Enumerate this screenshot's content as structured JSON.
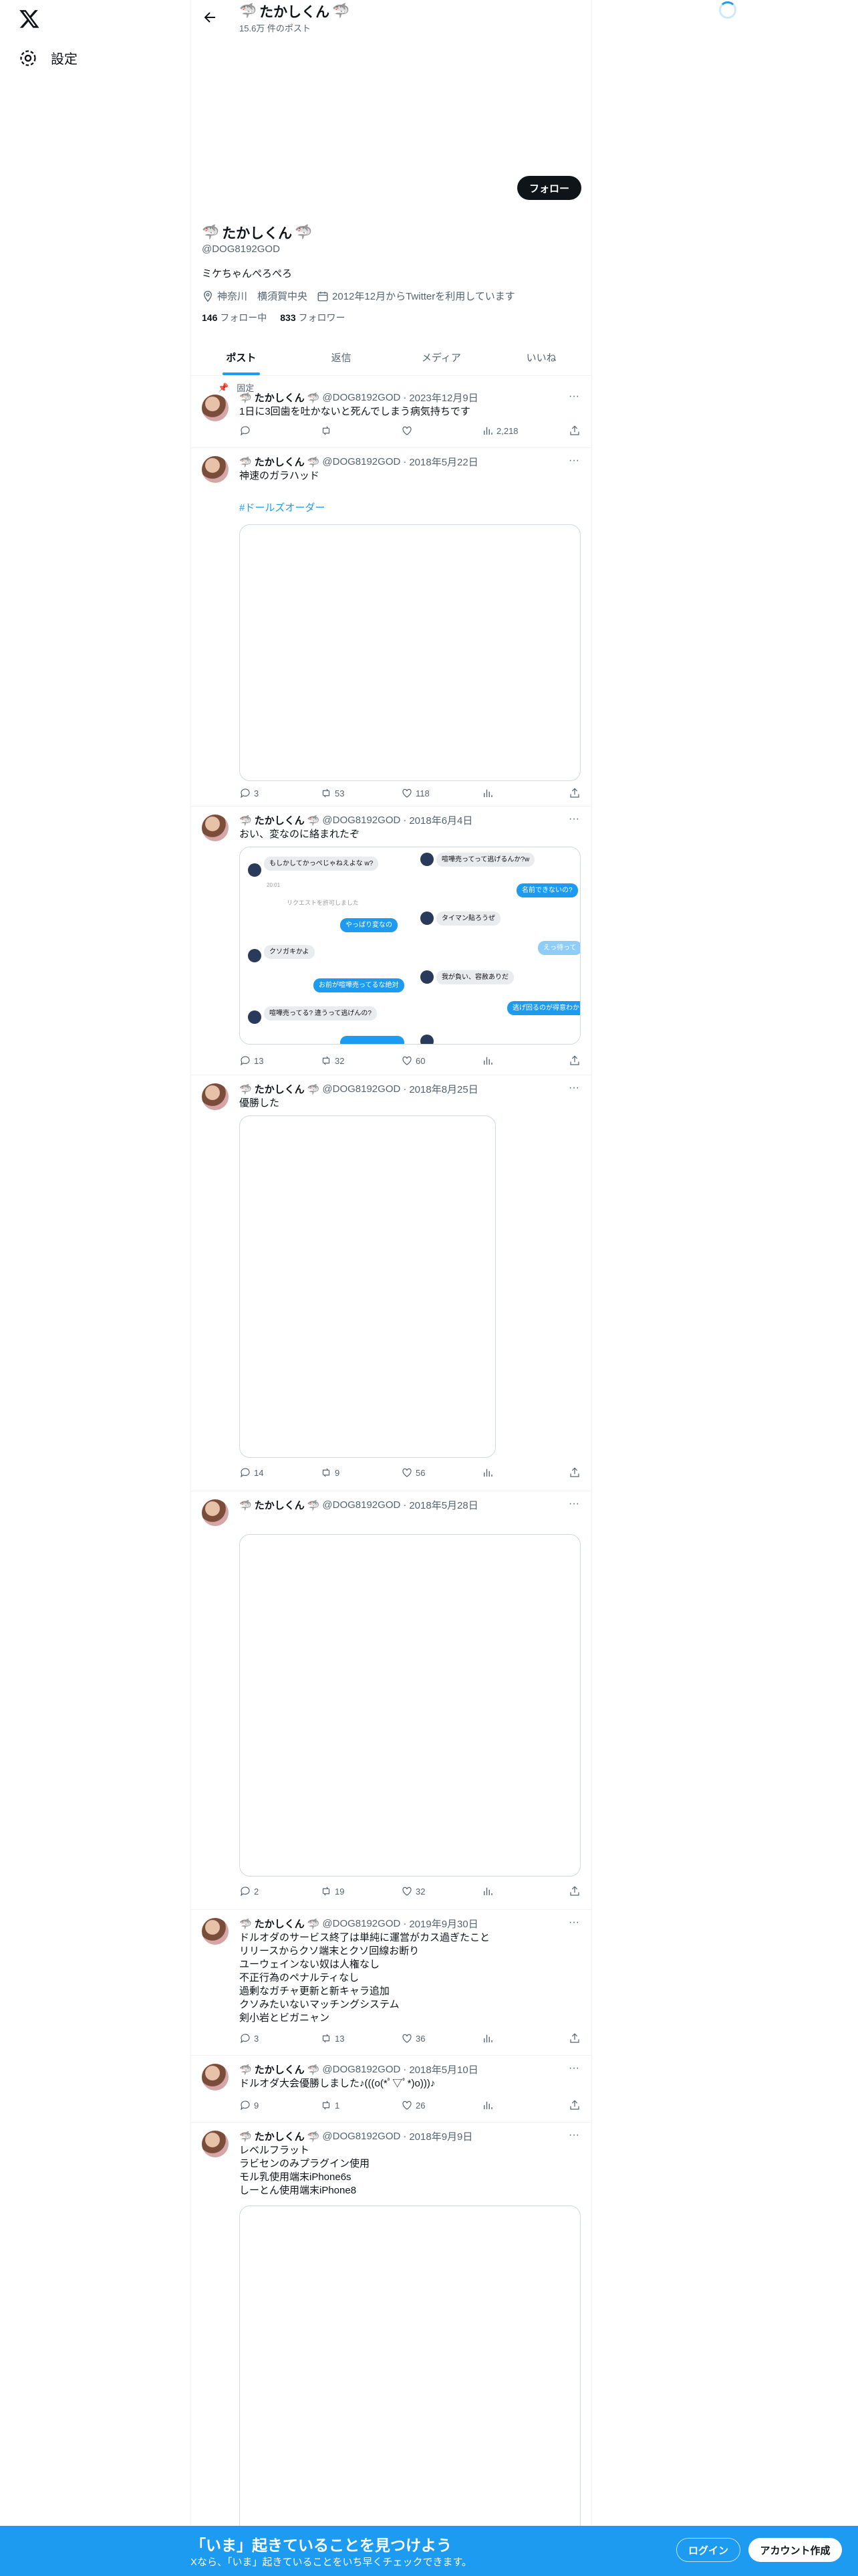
{
  "nav": {
    "settings_label": "設定"
  },
  "header": {
    "title": "たかしくん",
    "post_count": "15.6万 件のポスト"
  },
  "profile": {
    "follow_label": "フォロー",
    "name": "たかしくん",
    "handle": "@DOG8192GOD",
    "bio": "ミケちゃんぺろぺろ",
    "location": "神奈川　横須賀中央",
    "joined": "2012年12月からTwitterを利用しています",
    "following_count": "146",
    "following_label": "フォロー中",
    "followers_count": "833",
    "followers_label": "フォロワー"
  },
  "tabs": [
    {
      "label": "ポスト"
    },
    {
      "label": "返信"
    },
    {
      "label": "メディア"
    },
    {
      "label": "いいね"
    }
  ],
  "pinned_label": "固定",
  "posts": [
    {
      "name": "たかしくん",
      "handle": "@DOG8192GOD",
      "date": "2023年12月9日",
      "text": "1日に3回歯を吐かないと死んでしまう病気持ちです",
      "replies": "",
      "reposts": "",
      "likes": "",
      "views": "2,218"
    },
    {
      "name": "たかしくん",
      "handle": "@DOG8192GOD",
      "date": "2018年5月22日",
      "text": "神速のガラハッド",
      "hashtag": "#ドールズオーダー",
      "replies": "3",
      "reposts": "53",
      "likes": "118",
      "views": ""
    },
    {
      "name": "たかしくん",
      "handle": "@DOG8192GOD",
      "date": "2018年6月4日",
      "text": "おい、変なのに絡まれたぞ",
      "replies": "13",
      "reposts": "32",
      "likes": "60",
      "views": "",
      "chat": {
        "left_1": "もしかしてかっぺじゃねえよな w?",
        "left_2": "リクエストを許可しました",
        "right_1": "やっぱり変なの",
        "left_3": "クソガキかよ",
        "right_2": "お前が喧嘩売ってるな絶対",
        "left_4": "喧嘩売ってる? 違うって逃げんの?",
        "top_r1": "喧嘩売ってって逃げるんか?w",
        "top_r2": "名前できないの?",
        "top_r3": "タイマン貼ろうぜ",
        "top_r4": "えっ待って",
        "top_r5": "我が負い、容赦ありだ",
        "top_r6": "逃げ回るのが得意わかってるよ?"
      }
    },
    {
      "name": "たかしくん",
      "handle": "@DOG8192GOD",
      "date": "2018年8月25日",
      "text": "優勝した",
      "replies": "14",
      "reposts": "9",
      "likes": "56",
      "views": ""
    },
    {
      "name": "たかしくん",
      "handle": "@DOG8192GOD",
      "date": "2018年5月28日",
      "text": "",
      "replies": "2",
      "reposts": "19",
      "likes": "32",
      "views": ""
    },
    {
      "name": "たかしくん",
      "handle": "@DOG8192GOD",
      "date": "2019年9月30日",
      "text": "ドルオダのサービス終了は単純に運営がカス過ぎたこと\nリリースからクソ端末とクソ回線お断り\nユーウェインない奴は人権なし\n不正行為のペナルティなし\n過剰なガチャ更新と新キャラ追加\nクソみたいないマッチングシステム\n剣小岩とビガニャン",
      "replies": "3",
      "reposts": "13",
      "likes": "36",
      "views": ""
    },
    {
      "name": "たかしくん",
      "handle": "@DOG8192GOD",
      "date": "2018年5月10日",
      "text": "ドルオダ大会優勝しました♪(((o(*ﾟ▽ﾟ*)o)))♪",
      "replies": "9",
      "reposts": "1",
      "likes": "26",
      "views": ""
    },
    {
      "name": "たかしくん",
      "handle": "@DOG8192GOD",
      "date": "2018年9月9日",
      "text": "レベルフラット\nラビセンのみプラグイン使用\nモル乳使用端末iPhone6s\nしーとん使用端末iPhone8"
    }
  ],
  "bottom": {
    "title": "「いま」起きていることを見つけよう",
    "subtitle": "Xなら、「いま」起きていることをいち早くチェックできます。",
    "login_label": "ログイン",
    "signup_label": "アカウント作成"
  }
}
